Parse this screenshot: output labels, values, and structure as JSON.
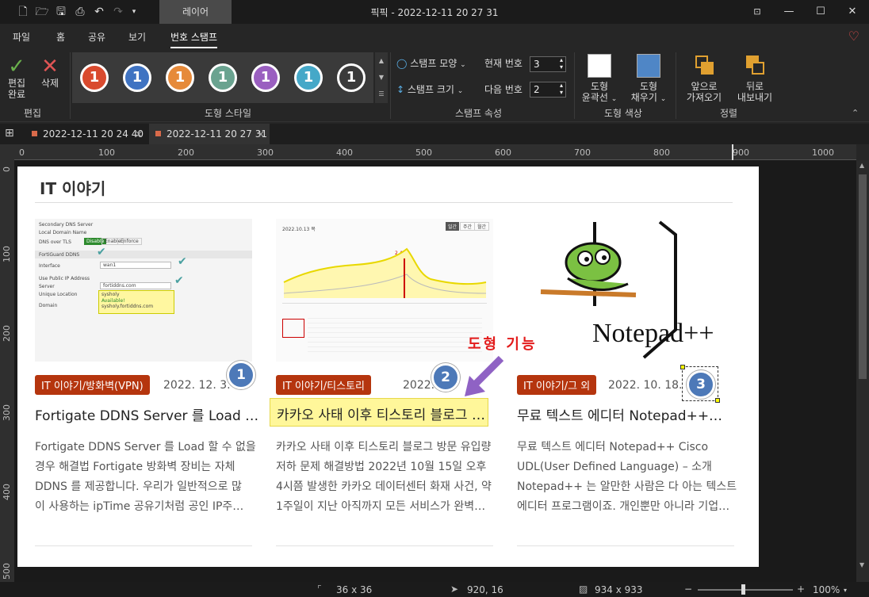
{
  "titlebar": {
    "title": "픽픽 - 2022-12-11 20 27 31",
    "layer_tab": "레이어"
  },
  "menu": {
    "file": "파일",
    "home": "홈",
    "share": "공유",
    "view": "보기",
    "stamp": "번호 스탬프"
  },
  "ribbon": {
    "edit_done": "편집\n완료",
    "edit_done_1": "편집",
    "edit_done_2": "완료",
    "delete": "삭제",
    "group_edit": "편집",
    "stamps": [
      {
        "label": "1",
        "color": "#d94a2e"
      },
      {
        "label": "1",
        "color": "#3f73c2"
      },
      {
        "label": "1",
        "color": "#e68a3a"
      },
      {
        "label": "1",
        "color": "#6aa390"
      },
      {
        "label": "1",
        "color": "#9a5fc0"
      },
      {
        "label": "1",
        "color": "#45a8c8"
      },
      {
        "label": "1",
        "color": "#3a3a3a"
      }
    ],
    "group_shape_style": "도형 스타일",
    "stamp_shape": "스탬프 모양",
    "stamp_size": "스탬프 크기",
    "current_number_label": "현재 번호",
    "current_number": "3",
    "next_number_label": "다음 번호",
    "next_number": "2",
    "group_stamp_props": "스탬프 속성",
    "shape_outline_1": "도형",
    "shape_outline_2": "윤곽선",
    "shape_fill_1": "도형",
    "shape_fill_2": "채우기",
    "group_shape_color": "도형 색상",
    "bring_front_1": "앞으로",
    "bring_front_2": "가져오기",
    "send_back_1": "뒤로",
    "send_back_2": "내보내기",
    "group_arrange": "정렬",
    "outline_color": "#ffffff",
    "fill_color": "#4f86c6"
  },
  "tabs": [
    {
      "label": "2022-12-11 20 24 40",
      "close": "×"
    },
    {
      "label": "2022-12-11 20 27 31",
      "close": "×"
    }
  ],
  "ruler": {
    "top": [
      "0",
      "100",
      "200",
      "300",
      "400",
      "500",
      "600",
      "700",
      "800",
      "900",
      "1000"
    ],
    "left": [
      "0",
      "100",
      "200",
      "300",
      "400",
      "500"
    ]
  },
  "page": {
    "heading": "IT 이야기",
    "cards": [
      {
        "category": "IT 이야기/방화벽(VPN)",
        "date": "2022. 12. 3.",
        "title": "Fortigate DDNS Server 를 Load …",
        "excerpt": [
          "Fortigate DDNS Server 를 Load 할 수 없을",
          "경우 해결법 Fortigate 방화벽 장비는 자체",
          "DDNS 를 제공합니다. 우리가 일반적으로 많",
          "이 사용하는 ipTime 공유기처럼 공인 IP주…"
        ],
        "stamp": "1"
      },
      {
        "category": "IT 이야기/티스토리",
        "date": "2022. 10.",
        "title": "카카오 사태 이후 티스토리 블로그 …",
        "excerpt": [
          "카카오 사태 이후 티스토리 블로그 방문 유입량",
          "저하 문제 해결방법 2022년 10월 15일 오후",
          "4시쯤 발생한 카카오 데이터센터 화재 사건, 약",
          "1주일이 지난 아직까지 모든 서비스가 완벽…"
        ],
        "stamp": "2"
      },
      {
        "category": "IT 이야기/그 외",
        "date": "2022. 10. 18.",
        "title": "무료 텍스트 에디터 Notepad++…",
        "excerpt": [
          "무료 텍스트 에디터 Notepad++ Cisco",
          "UDL(User Defined Language) – 소개",
          "Notepad++ 는 알만한 사람은 다 아는 텍스트",
          "에디터 프로그램이죠. 개인뿐만 아니라 기업…"
        ],
        "stamp": "3"
      }
    ],
    "annotation": "도형 기능",
    "thumb1": {
      "rows": [
        "Secondary DNS Server",
        "Local Domain Name",
        "DNS over TLS",
        "FortiGuard DDNS",
        "Interface",
        "Use Public IP Address",
        "Server",
        "Unique Location",
        "Domain"
      ],
      "tls_opts": [
        "Disable",
        "Enable",
        "Enforce"
      ],
      "iface": "wan1",
      "server": "fortiddns.com",
      "location": "sysholy",
      "available": "Available!",
      "domain": "sysholy.fortiddns.com"
    },
    "thumb2": {
      "date": "2022.10.13 목",
      "tabs": [
        "일간",
        "주간",
        "월간"
      ],
      "value": "2,405"
    },
    "thumb3": {
      "text": "Notepad++"
    }
  },
  "status": {
    "size": "36 x 36",
    "pos": "920, 16",
    "image": "934 x 933",
    "zoom": "100%"
  }
}
